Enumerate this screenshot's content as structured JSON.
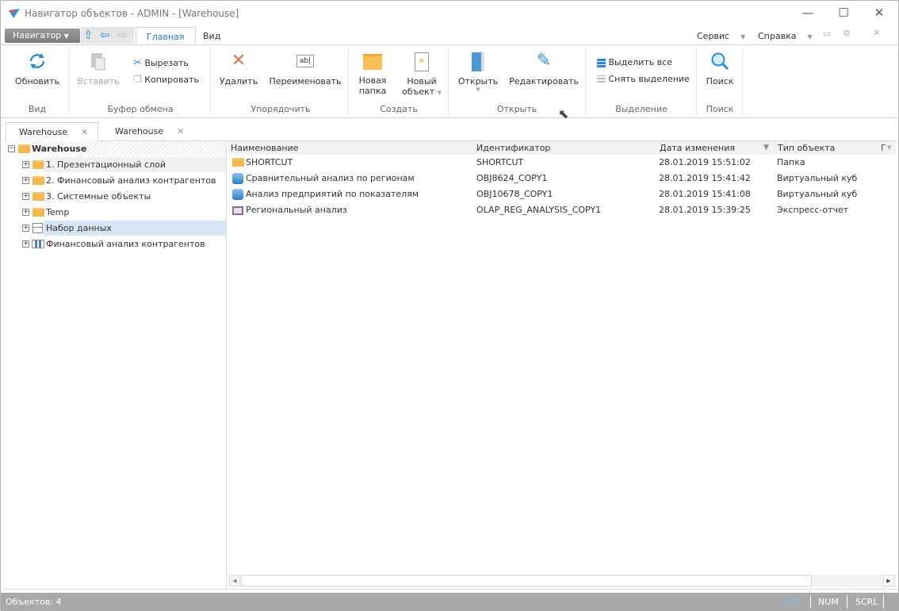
{
  "window": {
    "title": "Навигатор объектов - ADMIN - [Warehouse]",
    "minimize": "—",
    "maximize": "☐",
    "close": "✕"
  },
  "menubar": {
    "navigator_label": "Навигатор",
    "tabs": [
      {
        "label": "Главная"
      },
      {
        "label": "Вид"
      }
    ],
    "service": "Сервис",
    "help": "Справка"
  },
  "ribbon": {
    "refresh": "Обновить",
    "paste": "Вставить",
    "cut": "Вырезать",
    "copy": "Копировать",
    "delete": "Удалить",
    "rename": "Переименовать",
    "new_folder_1": "Новая",
    "new_folder_2": "папка",
    "new_object_1": "Новый",
    "new_object_2": "объект",
    "open": "Открыть",
    "edit": "Редактировать",
    "select_all": "Выделить все",
    "deselect": "Снять выделение",
    "search": "Поиск",
    "groups": {
      "view": "Вид",
      "clipboard": "Буфер обмена",
      "arrange": "Упорядочить",
      "create": "Создать",
      "open": "Открыть",
      "selection": "Выделение",
      "search": "Поиск"
    }
  },
  "doc_tabs": [
    {
      "label": "Warehouse"
    },
    {
      "label": "Warehouse"
    }
  ],
  "tree": {
    "root": "Warehouse",
    "items": [
      {
        "label": "1. Презентационный слой"
      },
      {
        "label": "2. Финансовый анализ контрагентов"
      },
      {
        "label": "3. Системные объекты"
      },
      {
        "label": "Temp"
      },
      {
        "label": "Набор данных"
      },
      {
        "label": "Финансовый анализ контрагентов"
      }
    ]
  },
  "list": {
    "columns": [
      "Наименование",
      "Идентификатор",
      "Дата изменения",
      "Тип объекта",
      "Г"
    ],
    "rows": [
      {
        "name": "SHORTCUT",
        "id": "SHORTCUT",
        "date": "28.01.2019 15:51:02",
        "type": "Папка"
      },
      {
        "name": "Сравнительный анализ по регионам",
        "id": "OBJ8624_COPY1",
        "date": "28.01.2019 15:41:42",
        "type": "Виртуальный куб"
      },
      {
        "name": "Анализ предприятий по показателям",
        "id": "OBJ10678_COPY1",
        "date": "28.01.2019 15:41:08",
        "type": "Виртуальный куб"
      },
      {
        "name": "Региональный анализ",
        "id": "OLAP_REG_ANALYSIS_COPY1",
        "date": "28.01.2019 15:39:25",
        "type": "Экспресс-отчет"
      }
    ]
  },
  "status": {
    "objects": "Объектов: 4",
    "cap": "CAP",
    "num": "NUM",
    "scrl": "SCRL"
  }
}
